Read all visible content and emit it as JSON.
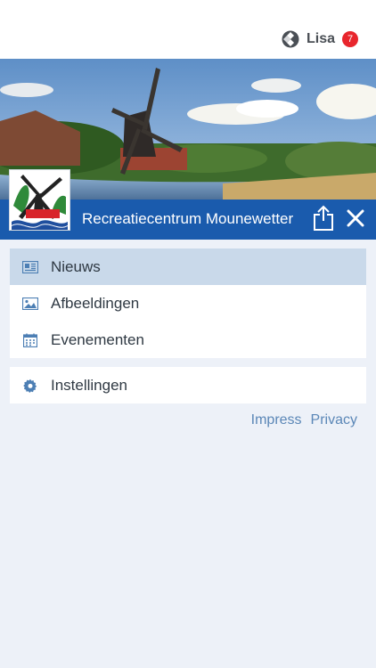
{
  "header": {
    "user_name": "Lisa",
    "notification_count": "7"
  },
  "site": {
    "title": "Recreatiecentrum Mounewetter"
  },
  "menu": {
    "items": [
      {
        "label": "Nieuws",
        "icon": "newspaper-icon",
        "active": true
      },
      {
        "label": "Afbeeldingen",
        "icon": "image-icon",
        "active": false
      },
      {
        "label": "Evenementen",
        "icon": "calendar-icon",
        "active": false
      }
    ],
    "settings_label": "Instellingen"
  },
  "footer": {
    "impress_label": "Impress",
    "privacy_label": "Privacy"
  },
  "colors": {
    "primary": "#1a5bad",
    "active_item": "#c9d9ea",
    "badge": "#e8262d",
    "link": "#5b87b7"
  }
}
